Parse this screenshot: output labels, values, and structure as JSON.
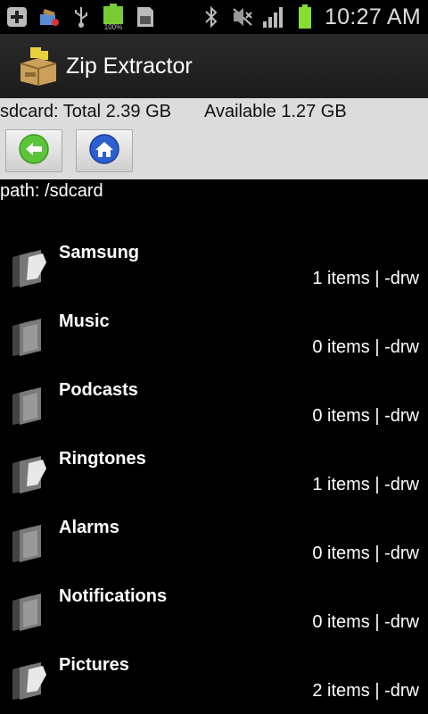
{
  "status_bar": {
    "time": "10:27 AM",
    "battery_percent_label": "100%",
    "left_icons": [
      "add-icon",
      "download-icon",
      "usb-icon",
      "battery-full-icon",
      "sd-card-icon"
    ],
    "right_icons": [
      "bluetooth-icon",
      "mute-icon",
      "signal-icon",
      "battery-icon"
    ]
  },
  "app": {
    "title": "Zip Extractor"
  },
  "storage": {
    "total": "sdcard: Total 2.39 GB",
    "available": "Available 1.27 GB"
  },
  "toolbar": {
    "buttons": [
      {
        "name": "back-button",
        "icon": "back-arrow-icon"
      },
      {
        "name": "home-button",
        "icon": "home-icon"
      }
    ]
  },
  "path": "path: /sdcard",
  "files": [
    {
      "name": "Samsung",
      "info": "1 items | -drw"
    },
    {
      "name": "Music",
      "info": "0 items | -drw"
    },
    {
      "name": "Podcasts",
      "info": "0 items | -drw"
    },
    {
      "name": "Ringtones",
      "info": "1 items | -drw"
    },
    {
      "name": "Alarms",
      "info": "0 items | -drw"
    },
    {
      "name": "Notifications",
      "info": "0 items | -drw"
    },
    {
      "name": "Pictures",
      "info": "2 items | -drw"
    }
  ],
  "colors": {
    "panel_bg": "#dcdcdc",
    "list_bg": "#000000",
    "back_button_green": "#5cc43a",
    "home_button_blue": "#2c5fd0"
  }
}
